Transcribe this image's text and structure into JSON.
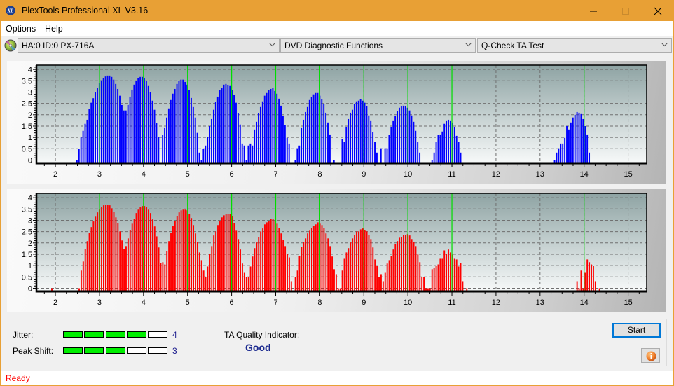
{
  "window": {
    "title": "PlexTools Professional XL V3.16",
    "app_icon": "xl-logo-icon",
    "controls": [
      "minimize",
      "maximize",
      "close"
    ]
  },
  "menu": {
    "items": [
      "Options",
      "Help"
    ]
  },
  "toolbar": {
    "drive_icon": "disc-icon",
    "drive": "HA:0 ID:0  PX-716A",
    "function": "DVD Diagnostic Functions",
    "test": "Q-Check TA Test"
  },
  "chart_data": [
    {
      "type": "bar",
      "title": "",
      "xlabel": "",
      "ylabel": "",
      "xlim": [
        1.57,
        15.42
      ],
      "ylim": [
        -0.14,
        4.19
      ],
      "xticks": [
        2,
        3,
        4,
        5,
        6,
        7,
        8,
        9,
        10,
        11,
        12,
        13,
        14,
        15
      ],
      "xtick_labels": [
        "2",
        "3",
        "4",
        "5",
        "6",
        "7",
        "8",
        "9",
        "10",
        "11",
        "12",
        "13",
        "14",
        "15"
      ],
      "yticks": [
        0,
        0.5,
        1,
        1.5,
        2,
        2.5,
        3,
        3.5,
        4
      ],
      "ytick_labels": [
        "0",
        "0.5",
        "1",
        "1.5",
        "2",
        "2.5",
        "3",
        "3.5",
        "4"
      ],
      "grid": true,
      "marker_lines": [
        3,
        4,
        5,
        6,
        7,
        8,
        9,
        10,
        11,
        14
      ],
      "marker_color": "#00dd00",
      "x_step": 0.0463,
      "series": [
        {
          "color": "#0000ff",
          "segments": [
            {
              "x_start": 2.49,
              "values": [
                0,
                0.5,
                1.0,
                1.29,
                1.6,
                1.78,
                2.25,
                2.53,
                2.73,
                2.99,
                3.2,
                3.39,
                3.52,
                3.61,
                3.69,
                3.73,
                3.73,
                3.67,
                3.55,
                3.36,
                3.14,
                2.84,
                2.43,
                2.19,
                2.19,
                2.43,
                2.8,
                3.11,
                3.33,
                3.49,
                3.61,
                3.67,
                3.67,
                3.61,
                3.48,
                3.27,
                2.99,
                2.62,
                2.22,
                1.63,
                1.01,
                null,
                1.1,
                1.41,
                1.88,
                2.28,
                2.65,
                2.93,
                3.14,
                3.36,
                3.48,
                3.55,
                3.55,
                3.45,
                3.33,
                3.08,
                2.74,
                2.34,
                1.88,
                1.2,
                0.33,
                0,
                0.5,
                0.64,
                1.01,
                1.5,
                1.81,
                2.22,
                2.56,
                2.8,
                3.08,
                3.2,
                3.33,
                3.36,
                3.3,
                3.27,
                3.08,
                2.87,
                2.53,
                2.06,
                1.57,
                0.73,
                0.64,
                0,
                0.64,
                0.73,
                0.64,
                1.35,
                1.69,
                2.06,
                2.34,
                2.59,
                2.84,
                2.96,
                3.08,
                3.14,
                3.18,
                3.05,
                2.93,
                2.71,
                2.4,
                1.94,
                1.54,
                0.98,
                0.73,
                null,
                null,
                0,
                0.52,
                0.64,
                1.41,
                1.78,
                2.12,
                2.34,
                2.65,
                2.77,
                2.9,
                2.96,
                2.96,
                2.84,
                2.68,
                2.49,
                2.09,
                1.66,
                1.13,
                null,
                0
              ]
            },
            {
              "x_start": 8.51,
              "values": [
                0.92,
                0.79,
                1.47,
                1.81,
                2.09,
                2.22,
                2.49,
                2.59,
                2.62,
                2.68,
                2.62,
                2.53,
                2.37,
                1.97,
                1.72,
                1.23,
                0.79,
                0.33,
                null,
                0.52,
                null,
                0.52,
                0.52,
                1.1,
                1.44,
                1.72,
                1.94,
                2.15,
                2.31,
                2.37,
                2.4,
                2.37,
                2.31,
                2.19,
                1.97,
                1.69,
                1.29,
                0.79,
                0.33
              ]
            },
            {
              "x_start": 10.55,
              "values": [
                0,
                0.33,
                0.79,
                1.1,
                1.13,
                1.26,
                1.6,
                1.72,
                1.78,
                1.72,
                1.66,
                1.44,
                1.07,
                0.79,
                0.33
              ]
            },
            {
              "x_start": 13.33,
              "values": [
                0,
                0.33,
                0.52,
                0.73,
                0.73,
                0.98,
                1.5,
                1.35,
                1.66,
                1.88,
                2.0,
                2.12,
                2.09,
                2.03,
                1.81,
                1.5,
                1.13,
                0.33
              ]
            }
          ]
        }
      ]
    },
    {
      "type": "bar",
      "title": "",
      "xlabel": "",
      "ylabel": "",
      "xlim": [
        1.57,
        15.42
      ],
      "ylim": [
        -0.14,
        4.19
      ],
      "xticks": [
        2,
        3,
        4,
        5,
        6,
        7,
        8,
        9,
        10,
        11,
        12,
        13,
        14,
        15
      ],
      "xtick_labels": [
        "2",
        "3",
        "4",
        "5",
        "6",
        "7",
        "8",
        "9",
        "10",
        "11",
        "12",
        "13",
        "14",
        "15"
      ],
      "yticks": [
        0,
        0.5,
        1,
        1.5,
        2,
        2.5,
        3,
        3.5,
        4
      ],
      "ytick_labels": [
        "0",
        "0.5",
        "1",
        "1.5",
        "2",
        "2.5",
        "3",
        "3.5",
        "4"
      ],
      "grid": true,
      "marker_lines": [
        3,
        4,
        5,
        6,
        7,
        8,
        9,
        10,
        11,
        14
      ],
      "marker_color": "#00dd00",
      "x_step": 0.0463,
      "series": [
        {
          "color": "#ff0000",
          "segments": [
            {
              "x_start": 1.92,
              "values": [
                0
              ]
            },
            {
              "x_start": 2.54,
              "values": [
                0,
                0.78,
                1.18,
                1.74,
                2.08,
                2.45,
                2.7,
                2.95,
                3.16,
                3.35,
                3.47,
                3.6,
                3.66,
                3.69,
                3.69,
                3.66,
                3.53,
                3.38,
                3.13,
                2.88,
                2.51,
                2.11,
                1.74,
                1.86,
                2.2,
                2.57,
                2.85,
                3.07,
                3.32,
                3.47,
                3.57,
                3.63,
                3.63,
                3.57,
                3.47,
                3.32,
                3.04,
                2.73,
                2.29,
                1.8,
                1.12,
                1.15,
                1.05,
                1.64,
                2.08,
                2.45,
                2.76,
                2.98,
                3.19,
                3.35,
                3.44,
                3.47,
                3.47,
                3.44,
                3.29,
                3.1,
                2.79,
                2.42,
                2.05,
                1.58,
                1.24,
                0.78,
                0.5,
                0.96,
                1.52,
                1.86,
                2.33,
                2.51,
                2.79,
                2.98,
                3.13,
                3.22,
                3.26,
                3.29,
                3.29,
                3.19,
                2.88,
                2.54,
                2.17,
                1.71,
                1.09,
                0.71,
                0.5,
                0.5,
                0.96,
                1.4,
                1.77,
                2.02,
                2.26,
                2.51,
                2.64,
                2.82,
                2.91,
                2.98,
                3.07,
                3.07,
                2.98,
                2.85,
                2.67,
                2.42,
                2.14,
                1.86,
                1.52,
                1.36,
                0.31,
                null,
                0.5,
                0.78,
                1.43,
                1.83,
                2.05,
                2.2,
                2.42,
                2.54,
                2.67,
                2.76,
                2.82,
                2.91,
                2.85,
                2.79,
                2.67,
                2.42,
                2.2,
                1.86,
                1.4,
                0.84,
                0.62,
                0,
                0,
                0.78,
                1.33,
                1.58,
                1.77,
                2.02,
                2.2,
                2.36,
                2.51,
                2.51,
                2.6,
                2.64,
                2.57,
                2.51,
                2.36,
                2.17,
                1.8,
                1.27,
                0.99,
                0.5,
                0.62,
                0.31,
                0.71,
                1.09,
                1.24,
                1.43,
                1.71,
                1.95,
                2.08,
                2.23,
                2.26,
                2.36,
                2.36,
                2.39,
                2.33,
                2.17,
                2.05,
                1.86,
                1.49,
                1.15,
                0.5,
                0.5,
                0,
                0,
                0,
                0.84,
                0.9,
                0.99,
                1.05,
                1.33,
                1.33,
                1.67,
                1.52,
                1.71,
                1.58,
                1.49,
                1.33,
                1.27,
                0.96,
                1.12,
                0.31,
                null,
                0
              ]
            },
            {
              "x_start": 13.84,
              "values": [
                0.31,
                0,
                0.78,
                0,
                0.71,
                1.27,
                1.15,
                1.05,
                0.99,
                0.31,
                null,
                0
              ]
            }
          ]
        }
      ]
    }
  ],
  "results": {
    "jitter": {
      "label": "Jitter:",
      "value": 4,
      "max": 5,
      "value_text": "4"
    },
    "peak_shift": {
      "label": "Peak Shift:",
      "value": 3,
      "max": 5,
      "value_text": "3"
    },
    "ta_quality": {
      "label": "TA Quality Indicator:",
      "value": "Good"
    }
  },
  "buttons": {
    "start": "Start",
    "info_icon": "info-icon"
  },
  "status": {
    "text": "Ready"
  },
  "colors": {
    "titlebar": "#e8a035",
    "meter_on": "#00ee00",
    "quality_text": "#1b2a8f",
    "status_text": "#ff0000",
    "focus_border": "#0078d7"
  }
}
